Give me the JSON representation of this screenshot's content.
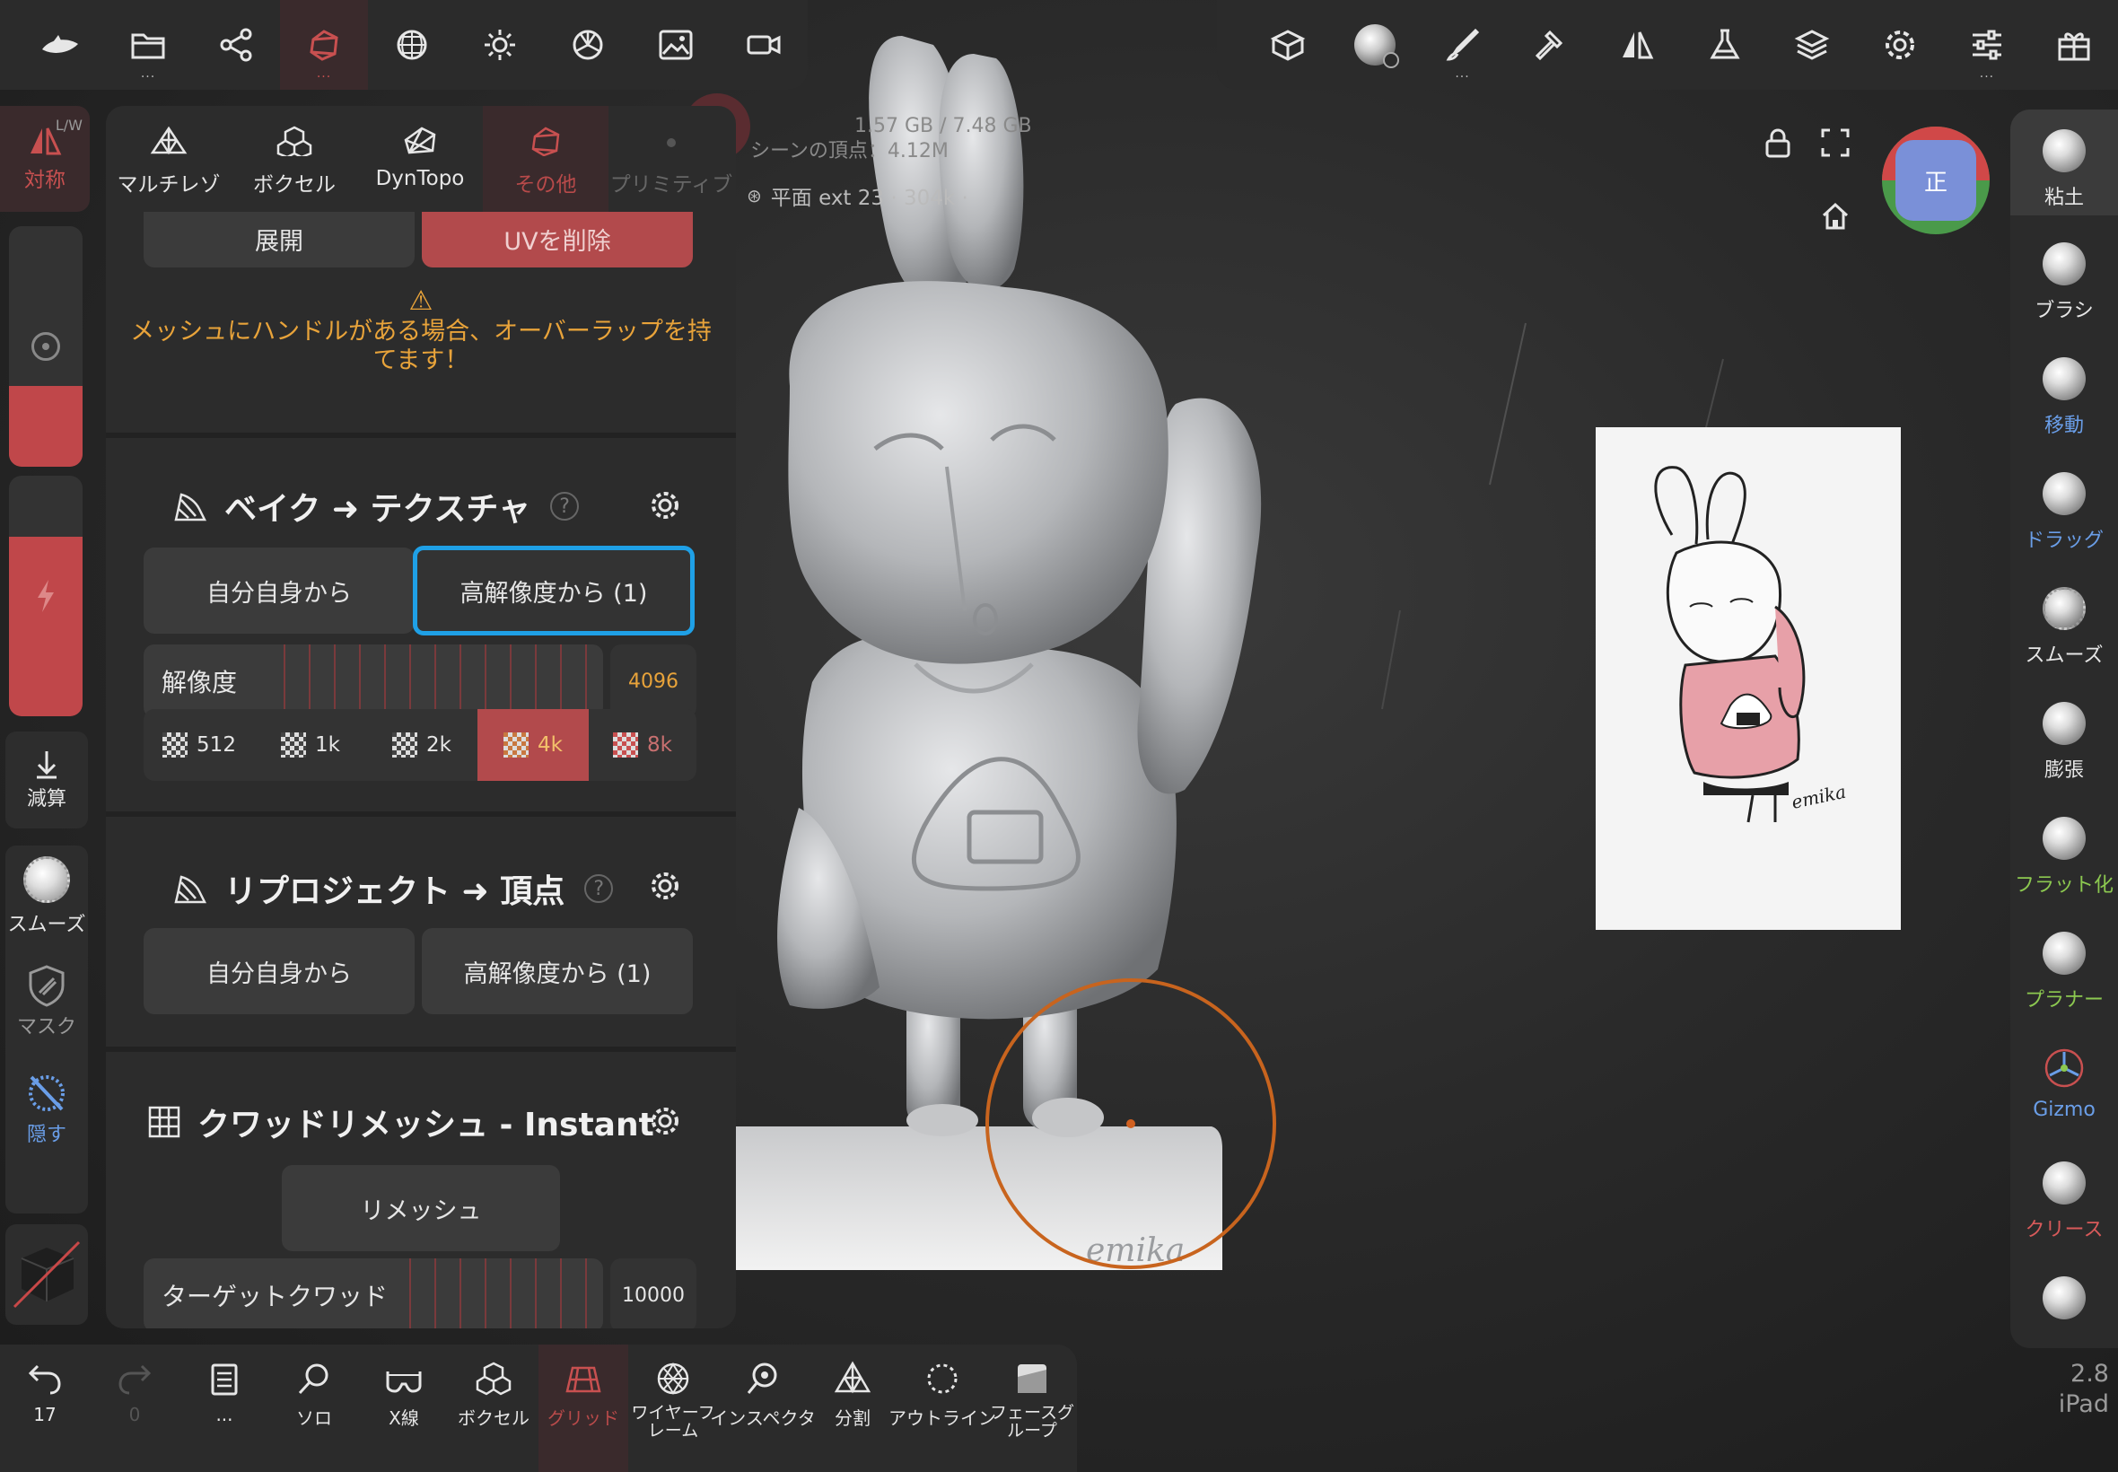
{
  "top_left_toolbar": {
    "items": [
      {
        "name": "logo-icon"
      },
      {
        "name": "folder-icon",
        "dots": "..."
      },
      {
        "name": "share-icon"
      },
      {
        "name": "topology-icon",
        "dots": "...",
        "active": true
      },
      {
        "name": "sphere-icon"
      },
      {
        "name": "light-icon"
      },
      {
        "name": "material-icon"
      },
      {
        "name": "image-icon"
      },
      {
        "name": "camera-icon"
      }
    ]
  },
  "top_right_toolbar": {
    "items": [
      {
        "name": "box-icon"
      },
      {
        "name": "matcap-icon"
      },
      {
        "name": "paint-icon",
        "dots": "..."
      },
      {
        "name": "hammer-icon"
      },
      {
        "name": "mirror-icon"
      },
      {
        "name": "flask-icon"
      },
      {
        "name": "layers-icon"
      },
      {
        "name": "settings-icon"
      },
      {
        "name": "sliders-icon",
        "dots": "..."
      },
      {
        "name": "gift-icon"
      }
    ]
  },
  "left_column": {
    "symmetry_label": "対称",
    "symmetry_badge": "L/W",
    "subtract_label": "減算",
    "smooth_label": "スムーズ",
    "mask_label": "マスク",
    "hide_label": "隠す"
  },
  "panel": {
    "tabs": [
      {
        "label": "マルチレゾ"
      },
      {
        "label": "ボクセル"
      },
      {
        "label": "DynTopo"
      },
      {
        "label": "その他",
        "active": true
      },
      {
        "label": "プリミティブ"
      }
    ],
    "unwrap_label": "展開",
    "delete_uv_label": "UVを削除",
    "warning_icon": "⚠",
    "warning_text": "メッシュにハンドルがある場合、オーバーラップを持てます！",
    "bake": {
      "title": "ベイク ➜ テクスチャ",
      "help": "?",
      "from_self": "自分自身から",
      "from_high": "高解像度から (1)",
      "resolution_label": "解像度",
      "resolution_value": "4096",
      "resolutions": [
        "512",
        "1k",
        "2k",
        "4k",
        "8k"
      ],
      "selected": "4k"
    },
    "reproject": {
      "title": "リプロジェクト ➜ 頂点",
      "help": "?",
      "from_self": "自分自身から",
      "from_high": "高解像度から (1)"
    },
    "quad": {
      "title": "クワッドリメッシュ - Instant",
      "remesh_label": "リメッシュ",
      "target_label": "ターゲットクワッド",
      "target_value": "10000"
    }
  },
  "viewport": {
    "memory": "1.57 GB / 7.48 GB",
    "scene_vertices": "シーンの頂点：4.12M",
    "object_info": "平面 ext 23 · 304k ·",
    "cube_label": "正",
    "signature": "emika",
    "colors": {
      "accent": "#b24a4c",
      "brush_ring": "#c8641e",
      "selection": "#1fa0e6"
    }
  },
  "right_column": {
    "items": [
      {
        "label": "粘土",
        "color": "#e6e6e6",
        "active": true
      },
      {
        "label": "ブラシ",
        "color": "#e6e6e6"
      },
      {
        "label": "移動",
        "color": "#6a9ee8"
      },
      {
        "label": "ドラッグ",
        "color": "#6a9ee8"
      },
      {
        "label": "スムーズ",
        "color": "#e6e6e6"
      },
      {
        "label": "膨張",
        "color": "#e6e6e6"
      },
      {
        "label": "フラット化",
        "color": "#8cc850"
      },
      {
        "label": "プラナー",
        "color": "#8cc850"
      },
      {
        "label": "Gizmo",
        "color": "#6a9ee8"
      },
      {
        "label": "クリース",
        "color": "#d85a5a"
      }
    ]
  },
  "bottom_bar": {
    "items": [
      {
        "name": "undo-icon",
        "label": "17"
      },
      {
        "name": "redo-icon",
        "label": "0",
        "dim": true
      },
      {
        "name": "notes-icon",
        "label": "..."
      },
      {
        "name": "search-icon",
        "label": "ソロ"
      },
      {
        "name": "xray-icon",
        "label": "X線"
      },
      {
        "name": "voxel-icon",
        "label": "ボクセル"
      },
      {
        "name": "grid-icon",
        "label": "グリッド",
        "active": true
      },
      {
        "name": "wireframe-icon",
        "label": "ワイヤーフレーム"
      },
      {
        "name": "inspector-icon",
        "label": "インスペクタ"
      },
      {
        "name": "split-icon",
        "label": "分割"
      },
      {
        "name": "outline-icon",
        "label": "アウトライン"
      },
      {
        "name": "facegroup-icon",
        "label": "フェースグループ"
      }
    ]
  },
  "version": "2.8",
  "device": "iPad"
}
